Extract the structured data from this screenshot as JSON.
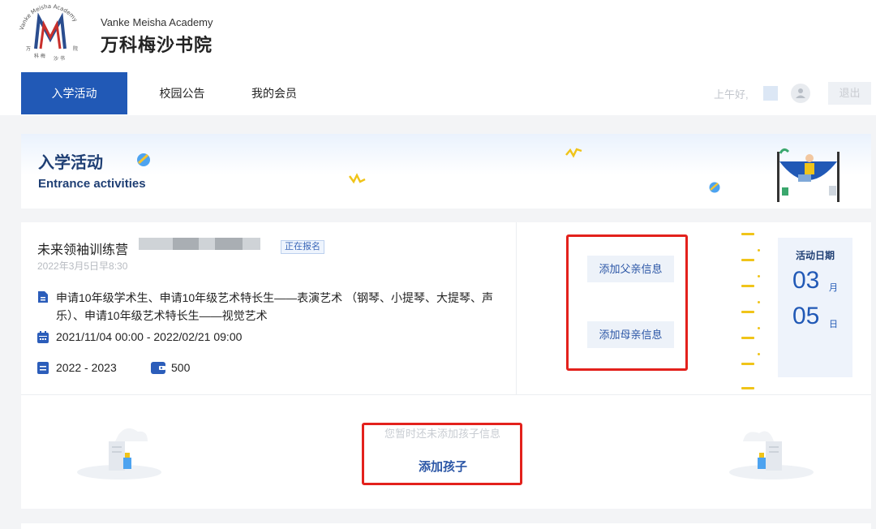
{
  "header": {
    "brand_en": "Vanke Meisha Academy",
    "brand_cn": "万科梅沙书院",
    "logo_ring_text": "Vanke Meisha Academy",
    "logo_ring_cn": "万科梅沙书院"
  },
  "nav": {
    "items": [
      {
        "label": "入学活动",
        "active": true
      },
      {
        "label": "校园公告",
        "active": false
      },
      {
        "label": "我的会员",
        "active": false
      }
    ]
  },
  "user": {
    "greeting": "上午好,",
    "logout_label": "退出"
  },
  "banner": {
    "title": "入学活动",
    "subtitle": "Entrance activities"
  },
  "activity": {
    "title": "未来领袖训练营",
    "status": "正在报名",
    "date_text": "2022年3月5日早8:30",
    "applications": "申请10年级学术生、申请10年级艺术特长生——表演艺术 （钢琴、小提琴、大提琴、声乐）、申请10年级艺术特长生——视觉艺术",
    "registration_range": "2021/11/04 00:00 - 2022/02/21 09:00",
    "school_year": "2022 - 2023",
    "fee": "500",
    "add_father_label": "添加父亲信息",
    "add_mother_label": "添加母亲信息",
    "activity_date_label": "活动日期",
    "month": "03",
    "month_unit": "月",
    "day": "05",
    "day_unit": "日"
  },
  "children": {
    "empty_hint": "您暂时还未添加孩子信息",
    "add_child_label": "添加孩子"
  },
  "colors": {
    "primary": "#2159b6",
    "heading": "#1f3f74",
    "highlight_box": "#e3211c",
    "timeline_accent": "#f0c419"
  }
}
